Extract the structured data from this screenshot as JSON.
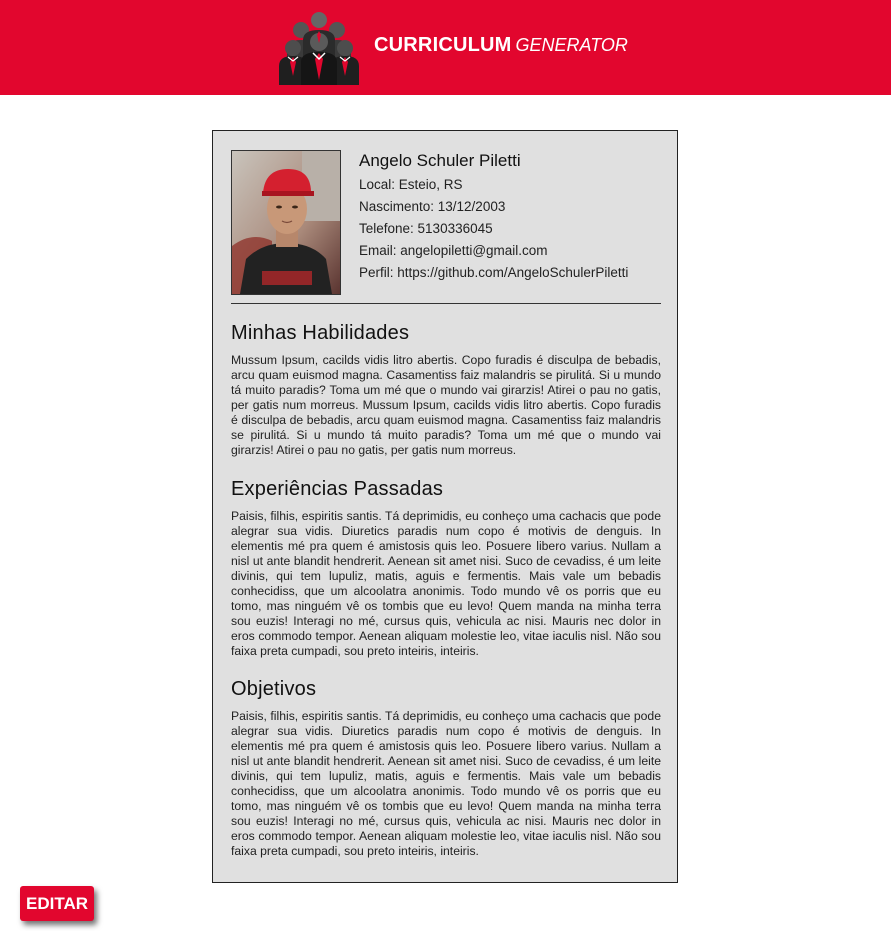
{
  "header": {
    "brand_main": "CURRICULUM",
    "brand_sub": "GENERATOR",
    "background": "#e2062e"
  },
  "profile": {
    "name": "Angelo Schuler Piletti",
    "local": "Local: Esteio, RS",
    "birth": "Nascimento: 13/12/2003",
    "phone": "Telefone: 5130336045",
    "email": "Email: angelopiletti@gmail.com",
    "profile_link": "Perfil: https://github.com/AngeloSchulerPiletti"
  },
  "sections": {
    "skills": {
      "title": "Minhas Habilidades",
      "text": "Mussum Ipsum, cacilds vidis litro abertis. Copo furadis é disculpa de bebadis, arcu quam euismod magna. Casamentiss faiz malandris se pirulitá. Si u mundo tá muito paradis? Toma um mé que o mundo vai girarzis! Atirei o pau no gatis, per gatis num morreus. Mussum Ipsum, cacilds vidis litro abertis. Copo furadis é disculpa de bebadis, arcu quam euismod magna. Casamentiss faiz malandris se pirulitá. Si u mundo tá muito paradis? Toma um mé que o mundo vai girarzis! Atirei o pau no gatis, per gatis num morreus."
    },
    "experience": {
      "title": "Experiências Passadas",
      "text": "Paisis, filhis, espiritis santis. Tá deprimidis, eu conheço uma cachacis que pode alegrar sua vidis. Diuretics paradis num copo é motivis de denguis. In elementis mé pra quem é amistosis quis leo. Posuere libero varius. Nullam a nisl ut ante blandit hendrerit. Aenean sit amet nisi. Suco de cevadiss, é um leite divinis, qui tem lupuliz, matis, aguis e fermentis. Mais vale um bebadis conhecidiss, que um alcoolatra anonimis. Todo mundo vê os porris que eu tomo, mas ninguém vê os tombis que eu levo! Quem manda na minha terra sou euzis! Interagi no mé, cursus quis, vehicula ac nisi. Mauris nec dolor in eros commodo tempor. Aenean aliquam molestie leo, vitae iaculis nisl. Não sou faixa preta cumpadi, sou preto inteiris, inteiris."
    },
    "objectives": {
      "title": "Objetivos",
      "text": "Paisis, filhis, espiritis santis. Tá deprimidis, eu conheço uma cachacis que pode alegrar sua vidis. Diuretics paradis num copo é motivis de denguis. In elementis mé pra quem é amistosis quis leo. Posuere libero varius. Nullam a nisl ut ante blandit hendrerit. Aenean sit amet nisi. Suco de cevadiss, é um leite divinis, qui tem lupuliz, matis, aguis e fermentis. Mais vale um bebadis conhecidiss, que um alcoolatra anonimis. Todo mundo vê os porris que eu tomo, mas ninguém vê os tombis que eu levo! Quem manda na minha terra sou euzis! Interagi no mé, cursus quis, vehicula ac nisi. Mauris nec dolor in eros commodo tempor. Aenean aliquam molestie leo, vitae iaculis nisl. Não sou faixa preta cumpadi, sou preto inteiris, inteiris."
    }
  },
  "actions": {
    "edit_label": "EDITAR"
  },
  "icons": {
    "logo": "business-people-icon",
    "photo": "profile-photo"
  }
}
